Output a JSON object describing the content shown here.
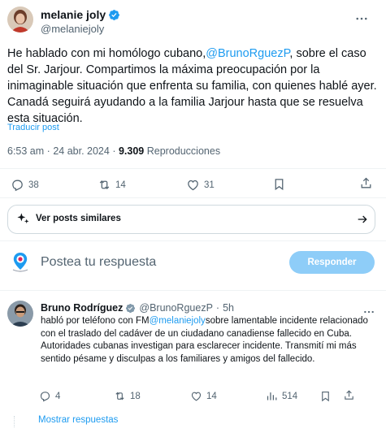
{
  "post": {
    "author_name": "melanie joly",
    "author_handle": "@melaniejoly",
    "text_before": "He hablado con mi homólogo cubano,",
    "mention": "@BrunoRguezP",
    "text_after": ", sobre el caso del Sr. Jarjour. Compartimos la máxima preocupación por la inimaginable situación que enfrenta su familia, con quienes hablé ayer. Canadá seguirá ayudando a la familia Jarjour hasta que se resuelva esta situación.",
    "translate_label": "Traducir post",
    "time": "6:53 am",
    "separator": "·",
    "date": "24 abr. 2024",
    "views_count": "9.309",
    "views_label": "Reproducciones"
  },
  "actions": {
    "replies": "38",
    "reposts": "14",
    "likes": "31"
  },
  "similar_posts_label": "Ver posts similares",
  "composer": {
    "placeholder": "Postea tu respuesta",
    "reply_button": "Responder"
  },
  "reply": {
    "author_name": "Bruno Rodríguez",
    "author_handle": "@BrunoRguezP",
    "separator": "·",
    "time": "5h",
    "text_before": "habló por teléfono con FM",
    "mention": "@melaniejoly",
    "text_after": "sobre lamentable incidente relacionado con el traslado del cadáver de un ciudadano canadiense fallecido en Cuba. Autoridades cubanas investigan para esclarecer incidente. Transmití mi más sentido pésame y disculpas a los familiares y amigos del fallecido.",
    "replies": "4",
    "reposts": "18",
    "likes": "14",
    "views": "514",
    "show_replies_label": "Mostrar respuestas"
  },
  "colors": {
    "accent": "#1d9bf0",
    "verified": "#1d9bf0",
    "secondary_text": "#536471",
    "reply_button_disabled": "#8ecdf8"
  },
  "icons": [
    "verified-badge-icon",
    "more-icon",
    "reply-icon",
    "repost-icon",
    "like-icon",
    "bookmark-icon",
    "share-icon",
    "sparkle-icon",
    "arrow-right-icon",
    "views-icon"
  ]
}
